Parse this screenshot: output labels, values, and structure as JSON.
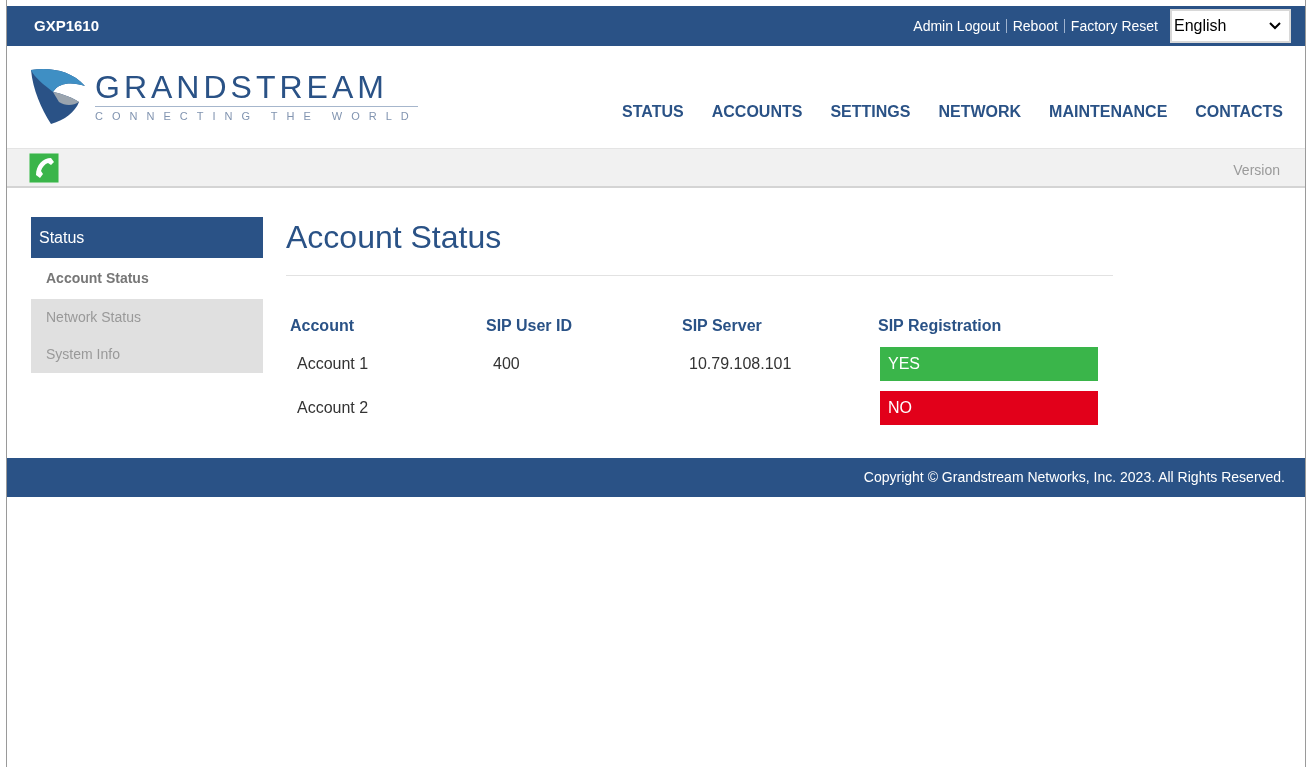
{
  "top_bar": {
    "model": "GXP1610",
    "links": [
      "Admin Logout",
      "Reboot",
      "Factory Reset"
    ],
    "language": "English"
  },
  "logo": {
    "name": "GRANDSTREAM",
    "tagline": "CONNECTING THE WORLD"
  },
  "nav": [
    {
      "label": "STATUS"
    },
    {
      "label": "ACCOUNTS"
    },
    {
      "label": "SETTINGS"
    },
    {
      "label": "NETWORK"
    },
    {
      "label": "MAINTENANCE"
    },
    {
      "label": "CONTACTS"
    }
  ],
  "sub_bar": {
    "version_link": "Version"
  },
  "sidebar": {
    "title": "Status",
    "items": [
      {
        "label": "Account Status",
        "selected": true
      },
      {
        "label": "Network Status",
        "selected": false
      },
      {
        "label": "System Info",
        "selected": false
      }
    ]
  },
  "page_title": "Account Status",
  "table": {
    "columns": [
      "Account",
      "SIP User ID",
      "SIP Server",
      "SIP Registration"
    ],
    "rows": [
      {
        "account": "Account 1",
        "user_id": "400",
        "server": "10.79.108.101",
        "registration": "YES",
        "registered": true
      },
      {
        "account": "Account 2",
        "registration": "NO",
        "registered": false
      }
    ]
  },
  "footer": "Copyright © Grandstream Networks, Inc. 2023. All Rights Reserved."
}
